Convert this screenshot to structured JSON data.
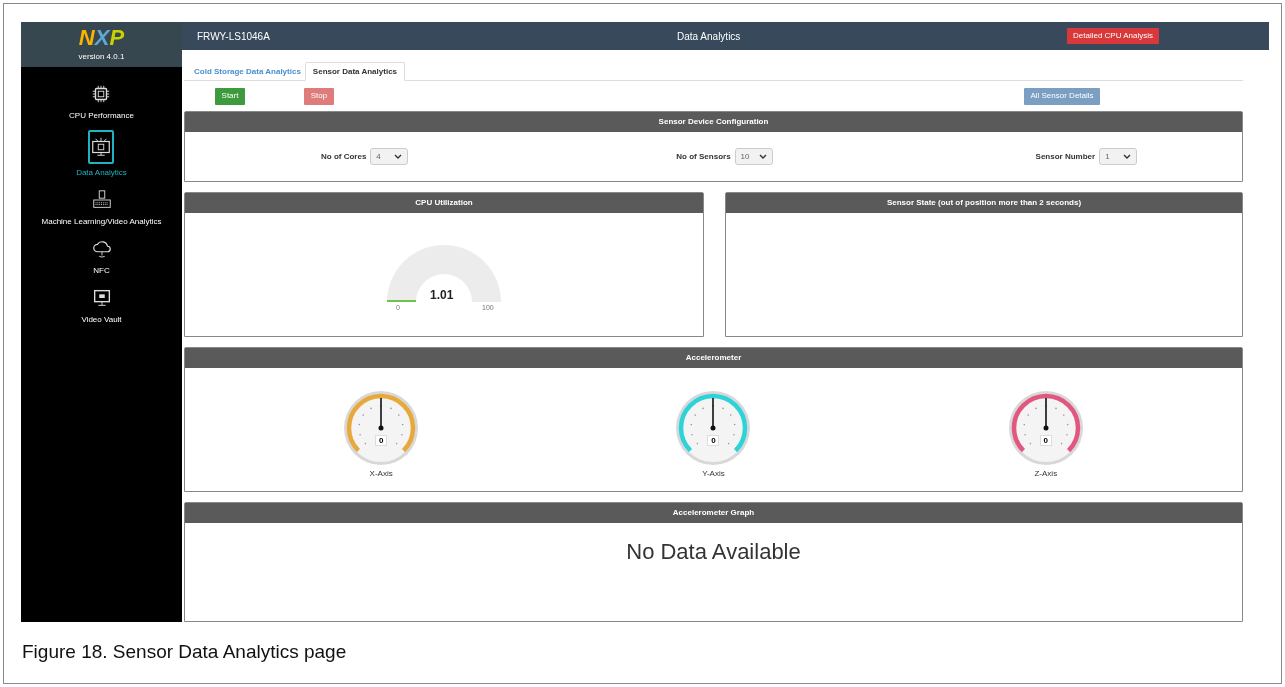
{
  "sidebar": {
    "logo": "NXP",
    "version": "version 4.0.1",
    "items": [
      {
        "kind": "chip",
        "label": "CPU Performance",
        "selected": false
      },
      {
        "kind": "monitor",
        "label": "Data Analytics",
        "selected": true
      },
      {
        "kind": "keyboard",
        "label": "Machine Learning/Video Analytics",
        "selected": false
      },
      {
        "kind": "cloud",
        "label": "NFC",
        "selected": false
      },
      {
        "kind": "screen",
        "label": "Video Vault",
        "selected": false
      }
    ]
  },
  "header": {
    "device": "FRWY-LS1046A",
    "title": "Data Analytics",
    "button": "Detailed CPU Analysis"
  },
  "tabs": [
    {
      "label": "Cold Storage Data Analytics",
      "selected": false
    },
    {
      "label": "Sensor Data Analytics",
      "selected": true
    }
  ],
  "actions": {
    "start": "Start",
    "stop": "Stop",
    "details": "All Sensor Details"
  },
  "config": {
    "title": "Sensor Device Configuration",
    "fields": [
      {
        "label": "No of Cores",
        "value": "4"
      },
      {
        "label": "No of Sensors",
        "value": "10"
      },
      {
        "label": "Sensor Number",
        "value": "1"
      }
    ]
  },
  "cpu": {
    "title": "CPU Utilization",
    "value": "1.01",
    "min": "0",
    "max": "100"
  },
  "sensor_state": {
    "title": "Sensor State (out of position more than 2 seconds)"
  },
  "accelerometer": {
    "title": "Accelerometer",
    "axes": [
      {
        "label": "X-Axis",
        "value": "0",
        "color": "#e8a93c"
      },
      {
        "label": "Y-Axis",
        "value": "0",
        "color": "#2ed3d8"
      },
      {
        "label": "Z-Axis",
        "value": "0",
        "color": "#e0577f"
      }
    ]
  },
  "graph": {
    "title": "Accelerometer Graph",
    "message": "No Data Available"
  },
  "caption": "Figure 18.  Sensor Data Analytics page"
}
